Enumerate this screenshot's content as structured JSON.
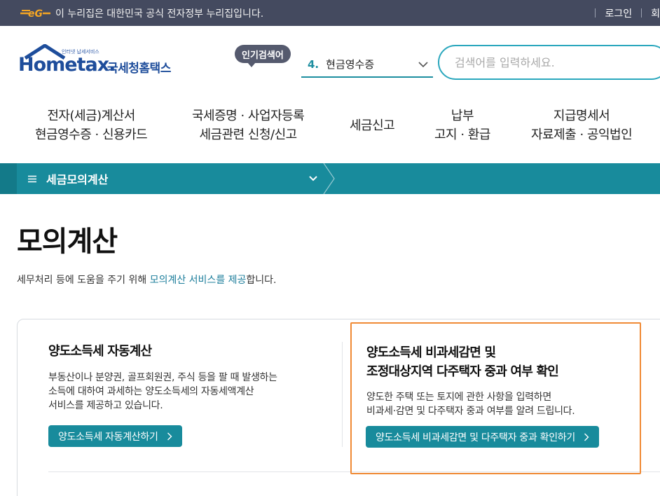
{
  "gov_bar": {
    "text": "이 누리집은 대한민국 공식 전자정부 누리집입니다.",
    "login": "로그인",
    "signup": "회"
  },
  "header": {
    "logo_small": "인터넷 납세서비스",
    "logo_main": "Hometax.",
    "logo_ko": "국세청홈택스",
    "popular_badge": "인기검색어",
    "popular_rank": "4.",
    "popular_term": "현금영수증",
    "search_placeholder": "검색어를 입력하세요."
  },
  "gnb": [
    {
      "line1": "전자(세금)계산서",
      "line2": "현금영수증 · 신용카드"
    },
    {
      "line1": "국세증명 · 사업자등록",
      "line2": "세금관련 신청/신고"
    },
    {
      "line1": "세금신고",
      "line2": ""
    },
    {
      "line1": "납부",
      "line2": "고지 · 환급"
    },
    {
      "line1": "지급명세서",
      "line2": "자료제출 · 공익법인"
    }
  ],
  "breadcrumb": {
    "label": "세금모의계산"
  },
  "page": {
    "title": "모의계산",
    "desc_prefix": "세무처리 등에 도움을 주기 위해 ",
    "desc_highlight": "모의계산 서비스를 제공",
    "desc_suffix": "합니다."
  },
  "cards": [
    {
      "title": "양도소득세 자동계산",
      "text": [
        "부동산이나 분양권, 골프회원권, 주식 등을 팔 때 발생하는",
        "소득에 대하여 과세하는 양도소득세의 자동세액계산",
        "서비스를 제공하고 있습니다."
      ],
      "button": "양도소득세 자동계산하기"
    },
    {
      "title_line1": "양도소득세 비과세감면 및",
      "title_line2": "조정대상지역 다주택자 중과 여부 확인",
      "text": [
        "양도한 주택 또는 토지에 관한 사항을 입력하면",
        "비과세·감면 및 다주택자 중과 여부를 알려 드립니다."
      ],
      "button": "양도소득세 비과세감면 및 다주택자 중과 확인하기"
    }
  ],
  "colors": {
    "gov_bar": "#444a5f",
    "accent": "#188b9c",
    "highlight_border": "#f08a35"
  }
}
